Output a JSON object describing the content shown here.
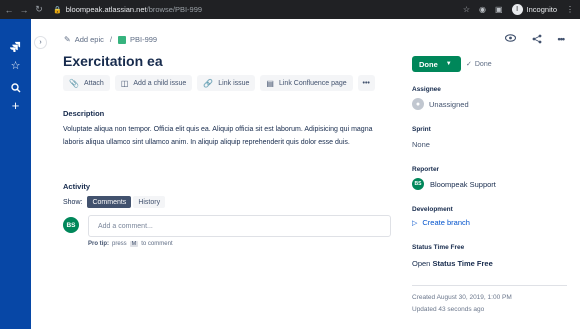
{
  "browser": {
    "url_host": "bloompeak.atlassian.net",
    "url_path": "/browse/PBI-999",
    "profile_initial": "I",
    "profile_label": "Incognito"
  },
  "breadcrumb": {
    "add_epic": "Add epic",
    "separator": "/",
    "issue_key": "PBI-999"
  },
  "issue": {
    "title": "Exercitation ea"
  },
  "toolbar": {
    "attach": "Attach",
    "add_child": "Add a child issue",
    "link_issue": "Link issue",
    "link_confluence": "Link Confluence page",
    "more": "•••"
  },
  "description": {
    "heading": "Description",
    "text": "Voluptate aliqua non tempor. Officia elit quis ea. Aliquip officia sit est laborum. Adipisicing qui magna laboris aliqua ullamco sint ullamco anim. In aliquip aliquip reprehenderit quis dolor esse duis."
  },
  "activity": {
    "heading": "Activity",
    "show_label": "Show:",
    "tabs": [
      "Comments",
      "History"
    ],
    "commenter_initials": "BS",
    "comment_placeholder": "Add a comment...",
    "protip_label": "Pro tip:",
    "protip_press": "press",
    "protip_key": "M",
    "protip_suffix": "to comment"
  },
  "sidebar": {
    "status": "Done",
    "resolution": "Done",
    "assignee_label": "Assignee",
    "assignee_value": "Unassigned",
    "sprint_label": "Sprint",
    "sprint_value": "None",
    "reporter_label": "Reporter",
    "reporter_initials": "BS",
    "reporter_value": "Bloompeak Support",
    "development_label": "Development",
    "create_branch": "Create branch",
    "stf_label": "Status Time Free",
    "stf_open": "Open",
    "stf_link": "Status Time Free",
    "created": "Created August 30, 2019, 1:00 PM",
    "updated": "Updated 43 seconds ago"
  },
  "colors": {
    "product_bar": "#0747A6",
    "status_done": "#00875A",
    "link": "#0052CC",
    "avatar_green": "#00875A"
  },
  "icons": [
    "jira-logo-icon",
    "star-icon",
    "search-icon",
    "plus-icon",
    "pencil-icon",
    "story-icon",
    "paperclip-icon",
    "hierarchy-icon",
    "link-icon",
    "confluence-icon",
    "eye-icon",
    "share-icon",
    "more-icon",
    "chevron-down-icon",
    "check-icon",
    "branch-icon"
  ]
}
